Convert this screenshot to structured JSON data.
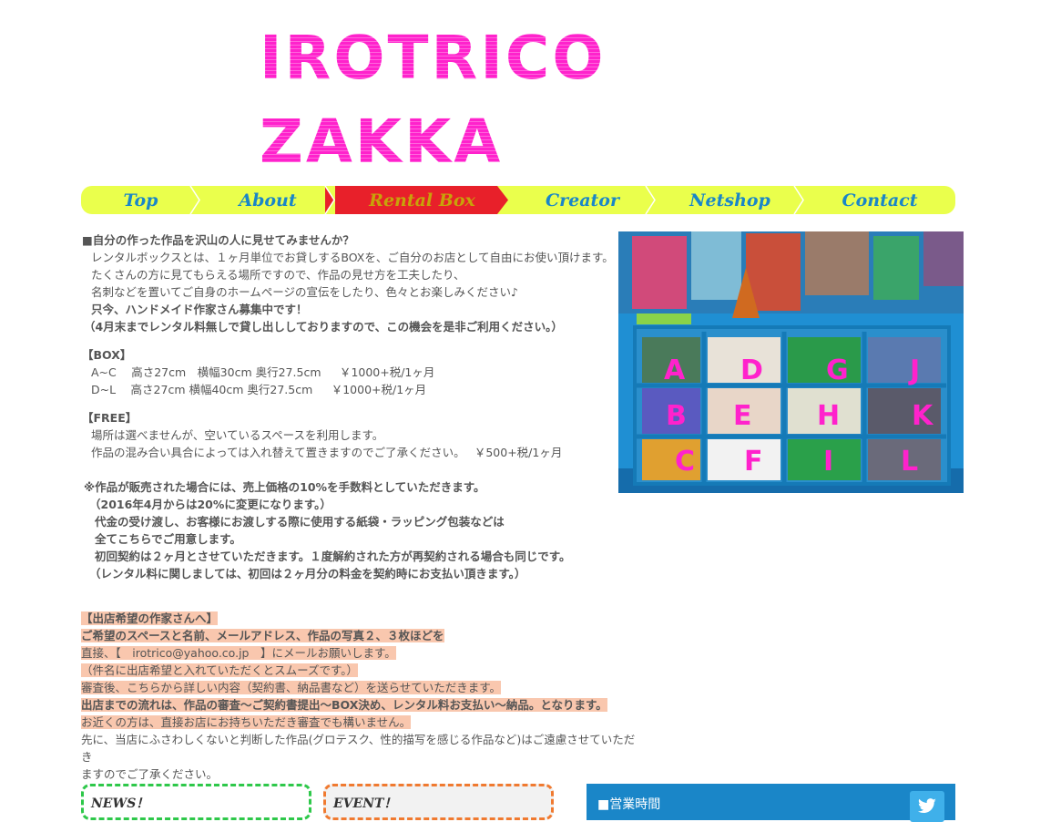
{
  "logo": {
    "line1": "IROTRICO",
    "line2": "ZAKKA"
  },
  "nav": {
    "items": [
      {
        "label": "Top"
      },
      {
        "label": "About"
      },
      {
        "label": "Rental Box"
      },
      {
        "label": "Creator"
      },
      {
        "label": "Netshop"
      },
      {
        "label": "Contact"
      }
    ],
    "active": "Rental Box",
    "colors": {
      "bar": "#eaff4c",
      "active": "#e8202a",
      "text": "#1a86c8"
    }
  },
  "intro": {
    "heading": "■自分の作った作品を沢山の人に見せてみませんか？",
    "line1": "レンタルボックスとは、１ヶ月単位でお貸しするBOXを、ご自分のお店として自由にお使い頂けます。",
    "line2": "たくさんの方に見てもらえる場所ですので、作品の見せ方を工夫したり、",
    "line3": "名刺などを置いてご自身のホームページの宣伝をしたり、色々とお楽しみください♪",
    "line4": "只今、ハンドメイド作家さん募集中です！",
    "line5": "（4月末までレンタル料無しで貸し出ししておりますので、この機会を是非ご利用ください。）"
  },
  "box": {
    "heading": "【BOX】",
    "row1": "A~C　 高さ27cm　横幅30cm 奥行27.5cm　  ￥1000+税/1ヶ月",
    "row2": "D~L　 高さ27cm 横幅40cm 奥行27.5cm　  ￥1000+税/1ヶ月"
  },
  "free": {
    "heading": "【FREE】",
    "line1": "場所は選べませんが、空いているスペースを利用します。",
    "line2": "作品の混み合い具合によっては入れ替えて置きますのでご了承ください。　 ￥500+税/1ヶ月"
  },
  "notes": {
    "line1": "※作品が販売された場合には、売上価格の10%を手数料としていただきます。",
    "line2": "（2016年4月からは20%に変更になります。）",
    "line3": "代金の受け渡し、お客様にお渡しする際に使用する紙袋・ラッピング包装などは",
    "line4": "全てこちらでご用意します。",
    "line5": "初回契約は２ヶ月とさせていただきます。１度解約された方が再契約される場合も同じです。",
    "line6": "（レンタル料に関しましては、初回は２ヶ月分の料金を契約時にお支払い頂きます。）"
  },
  "apply": {
    "line1": "【出店希望の作家さんへ】",
    "line2": "ご希望のスペースと名前、メールアドレス、作品の写真２、３枚ほどを",
    "line3": "直接、【　irotrico@yahoo.co.jp　】にメールお願いします。",
    "line4": "（件名に出店希望と入れていただくとスムーズです。）",
    "line5": "審査後、こちらから詳しい内容（契約書、納品書など）を送らせていただきます。",
    "line6": "出店までの流れは、作品の審査～ご契約書提出～BOX決め、レンタル料お支払い～納品。となります。",
    "line7": "お近くの方は、直接お店にお持ちいただき審査でも構いません。",
    "line8": "先に、当店にふさわしくないと判断した作品(グロテスク、性的描写を感じる作品など)はご遠慮させていただき",
    "line9": "ますのでご了承ください。"
  },
  "photo_labels": [
    "A",
    "B",
    "C",
    "D",
    "E",
    "F",
    "G",
    "H",
    "I",
    "J",
    "K",
    "L"
  ],
  "photo_label_color": "#ff22cc",
  "bottom": {
    "news": "NEWS！",
    "event": "EVENT！",
    "hours": "■営業時間",
    "twitter_icon": "twitter-bird-icon"
  }
}
